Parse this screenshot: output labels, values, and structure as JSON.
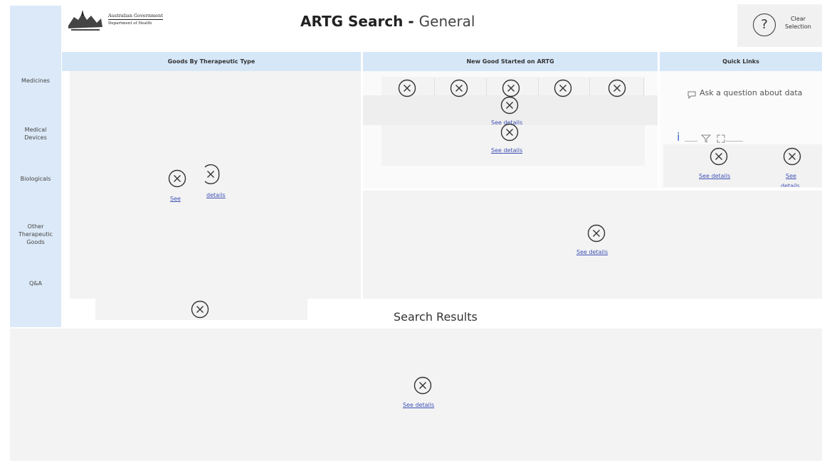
{
  "header": {
    "logo_line1": "Australian Government",
    "logo_line2": "Department of Health",
    "title_bold": "ARTG Search",
    "title_sep": " - ",
    "title_sub": "General",
    "help_symbol": "?",
    "clear_line1": "Clear",
    "clear_line2": "Selection"
  },
  "sidebar": {
    "items": [
      {
        "label": "Medicines"
      },
      {
        "label_lines": [
          "Medical",
          "Devices"
        ]
      },
      {
        "label": "Biologicals"
      },
      {
        "label_lines": [
          "Other",
          "Therapeutic",
          "Goods"
        ]
      },
      {
        "label": "Q&A"
      }
    ]
  },
  "sections": {
    "goods": "Goods By Therapeutic Type",
    "new_goods": "New Good Started on ARTG",
    "quick_links": "Quick Links",
    "search_results": "Search Results"
  },
  "links": {
    "see_details": "See details",
    "see": "See",
    "details": "details",
    "see_details_partial": "See details",
    "quick_see": "See",
    "quick_details_partial": "details"
  },
  "qa": {
    "text": "Ask a question about data"
  },
  "icons": {
    "error": "circle-x-icon",
    "help": "help-circle-icon",
    "comment": "comment-icon",
    "info": "info-icon",
    "filter": "filter-icon",
    "expand": "expand-icon"
  },
  "colors": {
    "nav_bg": "#dce9f8",
    "header_bg": "#d6e7f8",
    "panel_bg": "#f3f3f3",
    "link": "#3f51b5"
  }
}
